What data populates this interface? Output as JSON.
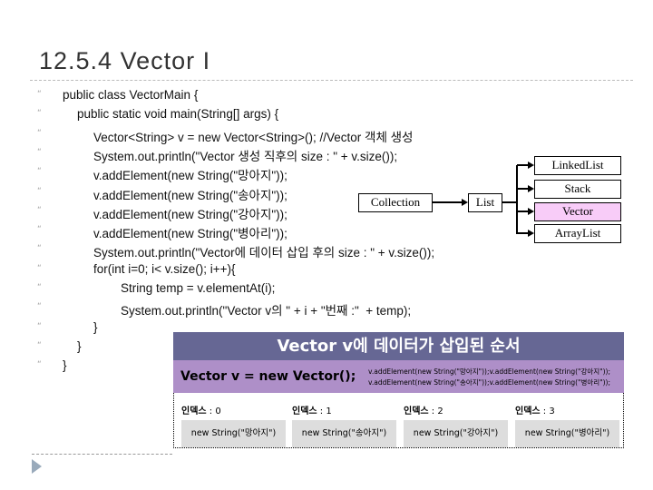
{
  "title": "12.5.4 Vector I",
  "code": [
    "public class VectorMain {",
    "public static void main(String[] args) {",
    "Vector<String> v = new Vector<String>(); //Vector 객체 생성",
    "System.out.println(\"Vector 생성 직후의 size : \" + v.size());",
    "v.addElement(new String(\"망아지\"));",
    "v.addElement(new String(\"송아지\"));",
    "v.addElement(new String(\"강아지\"));",
    "v.addElement(new String(\"병아리\"));",
    "System.out.println(\"Vector에 데이터 삽입 후의 size : \" + v.size());",
    "for(int i=0; i< v.size(); i++){",
    "String temp = v.elementAt(i);",
    "System.out.println(\"Vector v의 \" + i + \"번째 :\"  + temp);",
    "}",
    "}",
    "}"
  ],
  "bullet": "“",
  "diagram": {
    "collection": "Collection",
    "list": "List",
    "children": [
      "LinkedList",
      "Stack",
      "Vector",
      "ArrayList"
    ],
    "highlight": "Vector",
    "highlight_color": "#f8ccf8"
  },
  "panel": {
    "title": "Vector v에 데이터가 삽입된 순서",
    "constructor": "Vector v = new Vector();",
    "add_line1": "v.addElement(new String(\"망아지\"));v.addElement(new String(\"강아지\"));",
    "add_line2": "v.addElement(new String(\"송아지\"));v.addElement(new String(\"병아리\"));",
    "index_label": "인덱스",
    "indices": [
      " : 0",
      " : 1",
      " : 2",
      " : 3"
    ],
    "cells": [
      "new String(\"망아지\")",
      "new String(\"송아지\")",
      "new String(\"강아지\")",
      "new String(\"병아리\")"
    ]
  }
}
